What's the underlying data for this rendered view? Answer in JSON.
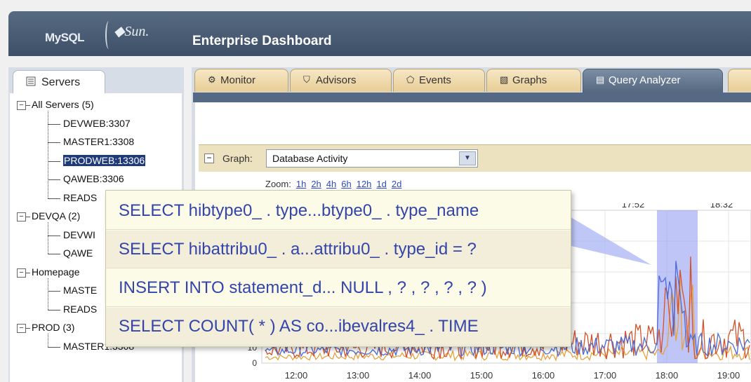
{
  "header": {
    "logo_mysql": "MySQL",
    "logo_sun": "Sun",
    "title": "Enterprise Dashboard"
  },
  "servers_panel": {
    "tab_label": "Servers",
    "groups": [
      {
        "label": "All Servers (5)",
        "servers": [
          "DEVWEB:3307",
          "MASTER1:3308",
          "PRODWEB:13306",
          "QAWEB:3306",
          "READS"
        ]
      },
      {
        "label": "DEVQA (2)",
        "servers": [
          "DEVWI",
          "QAWE"
        ]
      },
      {
        "label": "Homepage",
        "servers": [
          "MASTE",
          "READS"
        ]
      },
      {
        "label": "PROD (3)",
        "servers": [
          "MASTER1:3308"
        ]
      }
    ],
    "selected_server": "PRODWEB:13306"
  },
  "tabs": [
    {
      "label": "Monitor",
      "icon": "monitor-icon",
      "glyph": "⚙"
    },
    {
      "label": "Advisors",
      "icon": "shield-icon",
      "glyph": "⛉"
    },
    {
      "label": "Events",
      "icon": "bell-icon",
      "glyph": "⬠"
    },
    {
      "label": "Graphs",
      "icon": "graph-icon",
      "glyph": "▧"
    },
    {
      "label": "Query Analyzer",
      "icon": "query-icon",
      "glyph": "▤",
      "active": true
    }
  ],
  "graph": {
    "label": "Graph:",
    "selected": "Database Activity",
    "zoom_label": "Zoom:",
    "zoom_options": [
      "1h",
      "2h",
      "4h",
      "6h",
      "12h",
      "1d",
      "2d"
    ],
    "top_times": [
      "17:52",
      "18:32"
    ],
    "x_ticks": [
      "12:00",
      "13:00",
      "14:00",
      "15:00",
      "16:00",
      "17:00",
      "18:00",
      "19:00"
    ],
    "y_tick_zero": "0",
    "y_tick_partial": "10",
    "colors": {
      "series_a": "#d2522a",
      "series_b": "#e8a13c",
      "series_c": "#4d6bd6",
      "highlight": "#8a96f0"
    }
  },
  "queries": [
    "SELECT hibtype0_ . type...btype0_ . type_name",
    "SELECT hibattribu0_ . a...attribu0_ . type_id = ?",
    "INSERT INTO statement_d... NULL , ? , ? , ? , ? )",
    "SELECT COUNT( * ) AS co...ibevalres4_ . TIME"
  ]
}
